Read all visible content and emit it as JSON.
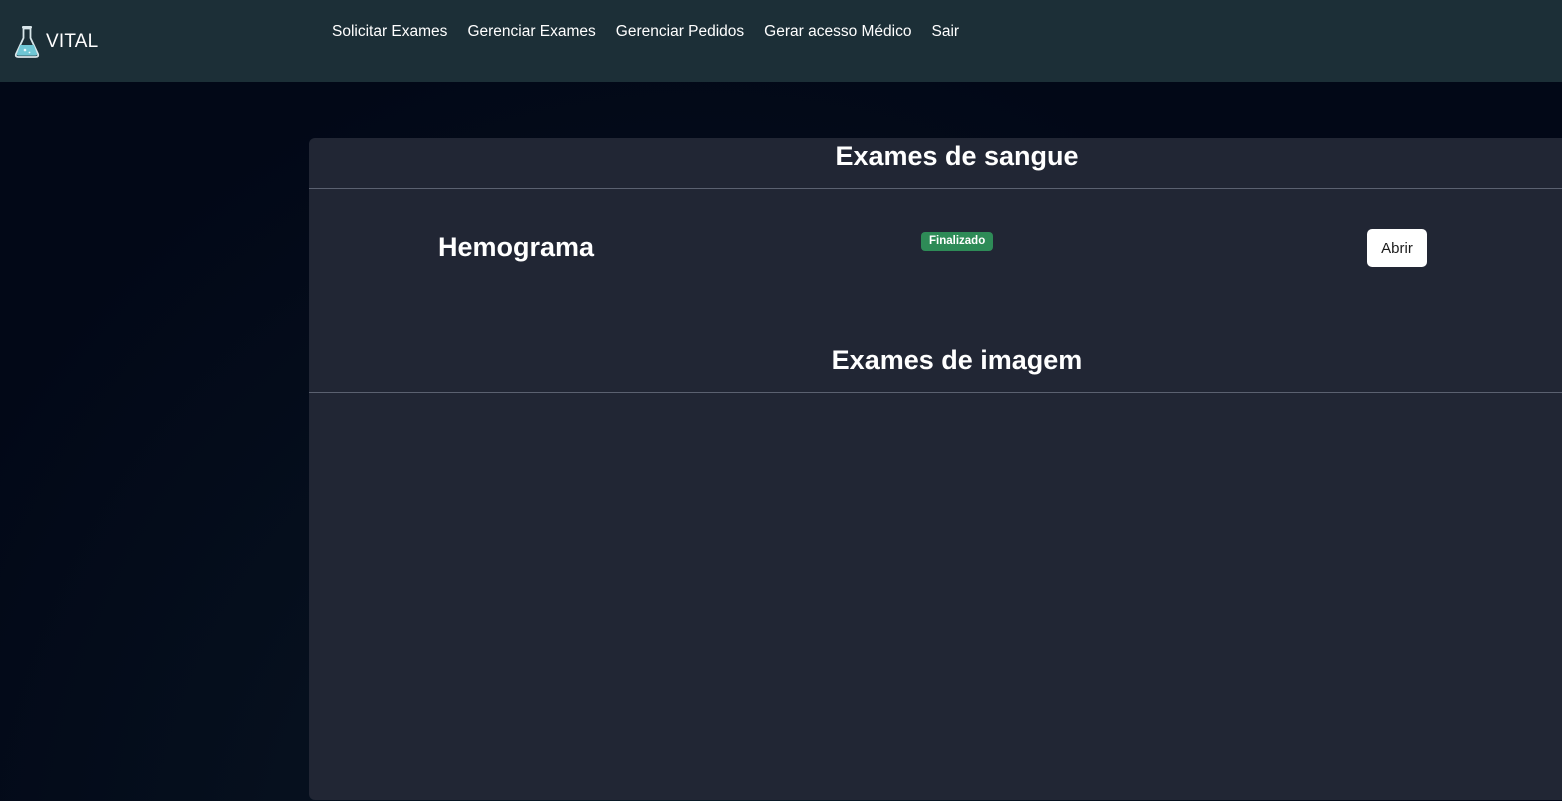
{
  "brand": {
    "name": "VITAL",
    "icon": "flask-icon"
  },
  "nav": {
    "items": [
      {
        "label": "Solicitar Exames"
      },
      {
        "label": "Gerenciar Exames"
      },
      {
        "label": "Gerenciar Pedidos"
      },
      {
        "label": "Gerar acesso Médico"
      },
      {
        "label": "Sair"
      }
    ]
  },
  "sections": {
    "blood": {
      "title": "Exames de sangue",
      "exams": [
        {
          "name": "Hemograma",
          "status": "Finalizado",
          "action": "Abrir"
        }
      ]
    },
    "imaging": {
      "title": "Exames de imagem",
      "exams": []
    }
  },
  "colors": {
    "navbar": "#1c2f37",
    "background": "#020817",
    "card": "#212634",
    "status_finalizado": "#2e8b57"
  }
}
